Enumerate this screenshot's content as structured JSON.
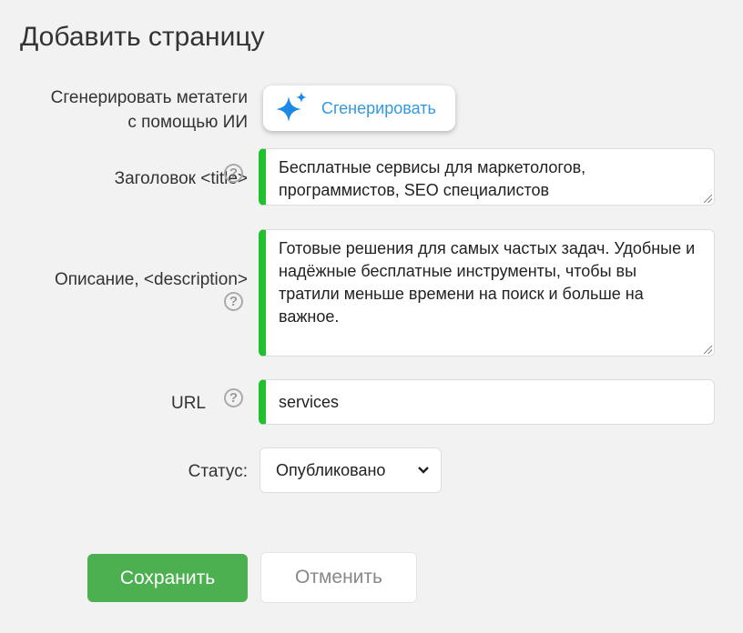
{
  "page": {
    "title": "Добавить страницу"
  },
  "ai": {
    "label_line1": "Сгенерировать метатеги",
    "label_line2": "с помощью ИИ",
    "button_label": "Сгенерировать",
    "icon": "sparkle-icon",
    "icon_color": "#1e88e5"
  },
  "title_field": {
    "label": "Заголовок <title>",
    "value_line1": "Бесплатные сервисы для маркетологов,",
    "value_line2": "программистов, SEO специалистов"
  },
  "description_field": {
    "label": "Описание, <description>",
    "value_line1": "Готовые решения для самых частых задач. Удобные и",
    "value_line2": "надёжные бесплатные инструменты, чтобы вы",
    "value_line3": "тратили меньше времени на поиск и больше на",
    "value_line4": "важное."
  },
  "url_field": {
    "label": "URL",
    "value": "services"
  },
  "status": {
    "label": "Статус:",
    "selected": "Опубликовано"
  },
  "help_icon": "?",
  "actions": {
    "save_label": "Сохранить",
    "cancel_label": "Отменить"
  },
  "colors": {
    "accent_green": "#22c02e",
    "save_button": "#4caf50",
    "link_blue": "#3399dd"
  }
}
